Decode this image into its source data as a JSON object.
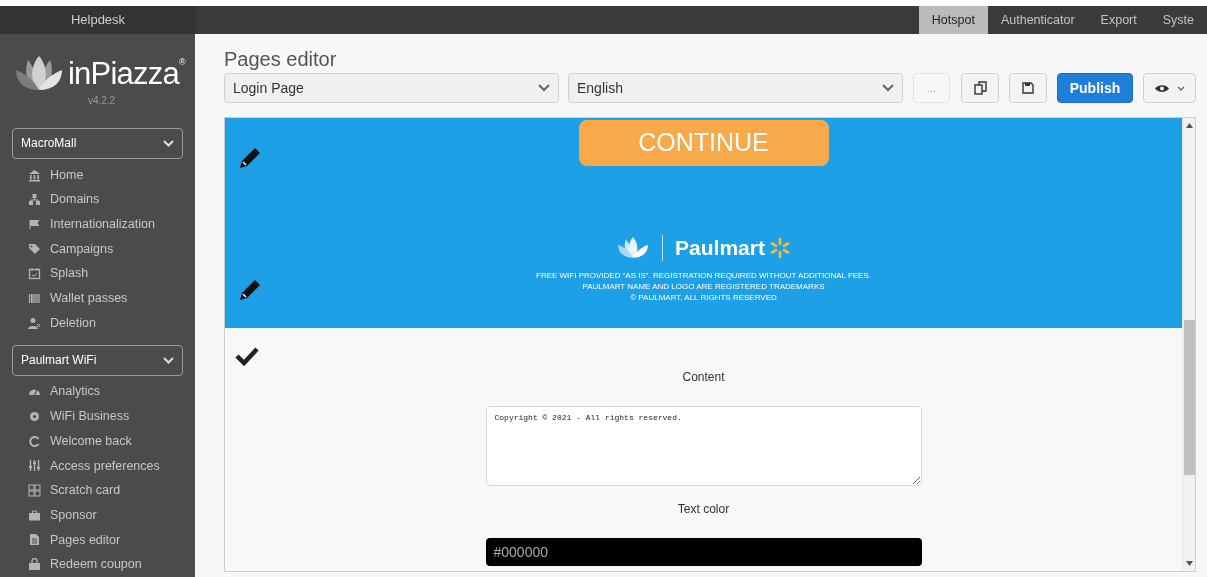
{
  "top_nav": {
    "sidebar_title": "Helpdesk",
    "tabs": [
      {
        "label": "Hotspot",
        "selected": true
      },
      {
        "label": "Authenticator",
        "selected": false
      },
      {
        "label": "Export",
        "selected": false
      },
      {
        "label": "Syste",
        "selected": false
      }
    ]
  },
  "sidebar": {
    "logo": {
      "name": "inPiazza$^{®}$",
      "version": "v4.2.2"
    },
    "groups": [
      {
        "selector": "MacroMall",
        "items": [
          "Home",
          "Domains",
          "Internationalization",
          "Campaigns",
          "Splash",
          "Wallet passes",
          "Deletion"
        ]
      },
      {
        "selector": "Paulmart WiFi",
        "items": [
          "Analytics",
          "WiFi Business",
          "Welcome back",
          "Access preferences",
          "Scratch card",
          "Sponsor",
          "Pages editor",
          "Redeem coupon"
        ]
      }
    ]
  },
  "editor": {
    "title": "Pages editor",
    "page_select": "Login Page",
    "language_select": "English",
    "more_button": {
      "label": "...",
      "disabled": true
    },
    "publish_button": "Publish"
  },
  "preview": {
    "continue_button": "CONTINUE",
    "brand": "Paulmart",
    "footer_lines": [
      "FREE WIFI PROVIDED “AS IS”. REGISTRATION REQUIRED WITHOUT ADDITIONAL FEES.",
      "PAULMART NAME AND LOGO ARE REGISTERED TRADEMARKS",
      "© PAULMART, ALL RIGHTS RESERVED"
    ],
    "content_label": "Content",
    "content_value": "Copyright © 2021 - All rights reserved.",
    "text_color_label": "Text color",
    "text_color_value": "#000000"
  }
}
